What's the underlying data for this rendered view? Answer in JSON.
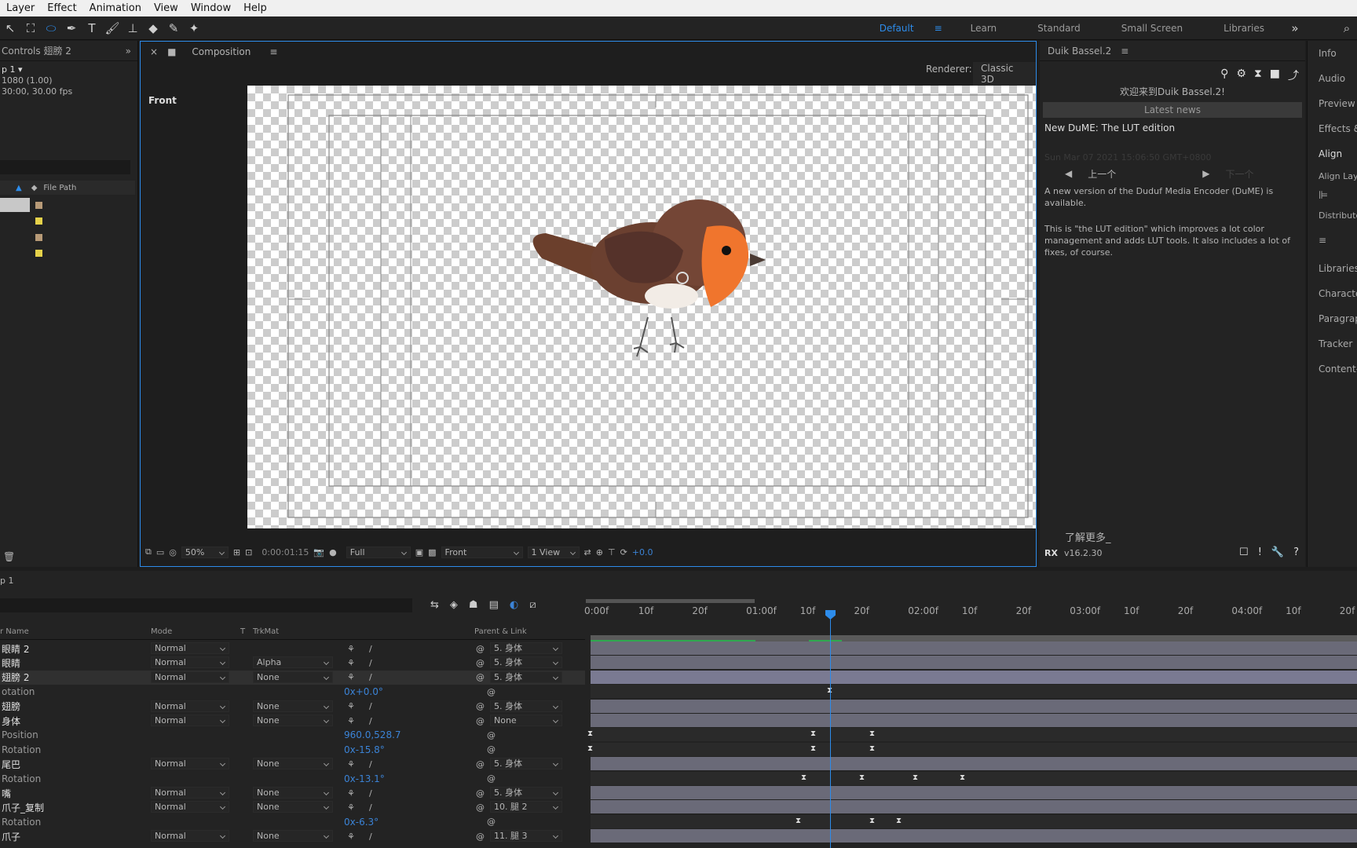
{
  "menu": [
    "Layer",
    "Effect",
    "Animation",
    "View",
    "Window",
    "Help"
  ],
  "workspaces": [
    "Default",
    "Learn",
    "Standard",
    "Small Screen",
    "Libraries"
  ],
  "left": {
    "header": "Controls 翅膀 2",
    "comp_name": "p 1 ▾",
    "res": "1080 (1.00)",
    "fps": "30:00, 30.00 fps",
    "col": "File Path"
  },
  "comp": {
    "tab": "Composition",
    "renderer_label": "Renderer:",
    "renderer": "Classic 3D",
    "view_label": "Front",
    "zoom": "50%",
    "time": "0:00:01:15",
    "quality": "Full",
    "camera": "Front",
    "views": "1 View",
    "exposure": "+0.0"
  },
  "duik": {
    "title": "Duik Bassel.2",
    "welcome": "欢迎来到Duik Bassel.2!",
    "latest": "Latest news",
    "news_title": "New DuME: The LUT edition",
    "date": "Sun Mar 07 2021 15:06:50 GMT+0800",
    "prev": "上一个",
    "next": "下一个",
    "p1": "A new version of the Duduf Media Encoder (DuME) is available.",
    "p2": "This is \"the LUT edition\" which improves a lot color management and adds LUT tools. It also includes a lot of fixes, of course.",
    "more": "了解更多_",
    "version": "v16.2.30"
  },
  "right": [
    "Info",
    "Audio",
    "Preview",
    "Effects &",
    "Align",
    "Align Laye",
    "Distribute",
    "Libraries",
    "Characte",
    "Paragrap",
    "Tracker",
    "Content-A"
  ],
  "tl": {
    "name": "p 1",
    "cols": {
      "name": "r Name",
      "mode": "Mode",
      "t": "T",
      "trk": "TrkMat",
      "parent": "Parent & Link"
    },
    "ruler": [
      "0:00f",
      "10f",
      "20f",
      "01:00f",
      "10f",
      "20f",
      "02:00f",
      "10f",
      "20f",
      "03:00f",
      "10f",
      "20f",
      "04:00f",
      "10f",
      "20f"
    ],
    "rows": [
      {
        "name": "眼睛 2",
        "mode": "Normal",
        "trk": "",
        "parent": "5. 身体",
        "val": ""
      },
      {
        "name": "眼睛",
        "mode": "Normal",
        "trk": "Alpha",
        "parent": "5. 身体",
        "val": ""
      },
      {
        "name": "翅膀 2",
        "mode": "Normal",
        "trk": "None",
        "parent": "5. 身体",
        "val": ""
      },
      {
        "name": "otation",
        "mode": "",
        "trk": "",
        "parent": "",
        "val": "0x+0.0°"
      },
      {
        "name": "翅膀",
        "mode": "Normal",
        "trk": "None",
        "parent": "5. 身体",
        "val": ""
      },
      {
        "name": "身体",
        "mode": "Normal",
        "trk": "None",
        "parent": "None",
        "val": ""
      },
      {
        "name": "Position",
        "mode": "",
        "trk": "",
        "parent": "",
        "val": "960.0,528.7"
      },
      {
        "name": "Rotation",
        "mode": "",
        "trk": "",
        "parent": "",
        "val": "0x-15.8°"
      },
      {
        "name": "尾巴",
        "mode": "Normal",
        "trk": "None",
        "parent": "5. 身体",
        "val": ""
      },
      {
        "name": "Rotation",
        "mode": "",
        "trk": "",
        "parent": "",
        "val": "0x-13.1°"
      },
      {
        "name": "嘴",
        "mode": "Normal",
        "trk": "None",
        "parent": "5. 身体",
        "val": ""
      },
      {
        "name": "爪子_复制",
        "mode": "Normal",
        "trk": "None",
        "parent": "10. 腿 2",
        "val": ""
      },
      {
        "name": "Rotation",
        "mode": "",
        "trk": "",
        "parent": "",
        "val": "0x-6.3°"
      },
      {
        "name": "爪子",
        "mode": "Normal",
        "trk": "None",
        "parent": "11. 腿 3",
        "val": ""
      }
    ]
  }
}
